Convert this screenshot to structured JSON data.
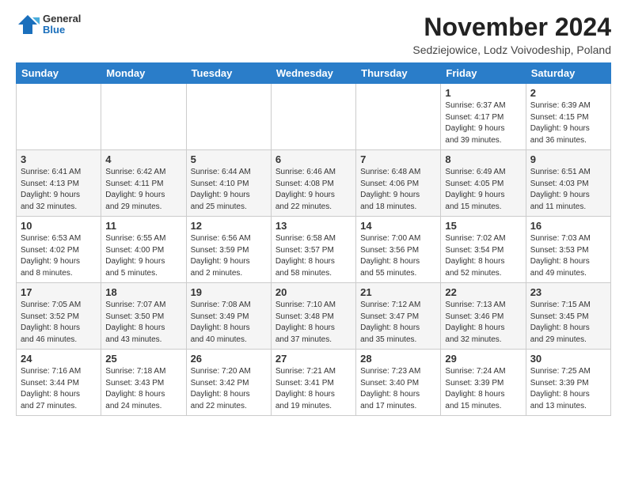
{
  "logo": {
    "general": "General",
    "blue": "Blue"
  },
  "title": "November 2024",
  "location": "Sedziejowice, Lodz Voivodeship, Poland",
  "headers": [
    "Sunday",
    "Monday",
    "Tuesday",
    "Wednesday",
    "Thursday",
    "Friday",
    "Saturday"
  ],
  "weeks": [
    [
      {
        "day": "",
        "info": ""
      },
      {
        "day": "",
        "info": ""
      },
      {
        "day": "",
        "info": ""
      },
      {
        "day": "",
        "info": ""
      },
      {
        "day": "",
        "info": ""
      },
      {
        "day": "1",
        "info": "Sunrise: 6:37 AM\nSunset: 4:17 PM\nDaylight: 9 hours\nand 39 minutes."
      },
      {
        "day": "2",
        "info": "Sunrise: 6:39 AM\nSunset: 4:15 PM\nDaylight: 9 hours\nand 36 minutes."
      }
    ],
    [
      {
        "day": "3",
        "info": "Sunrise: 6:41 AM\nSunset: 4:13 PM\nDaylight: 9 hours\nand 32 minutes."
      },
      {
        "day": "4",
        "info": "Sunrise: 6:42 AM\nSunset: 4:11 PM\nDaylight: 9 hours\nand 29 minutes."
      },
      {
        "day": "5",
        "info": "Sunrise: 6:44 AM\nSunset: 4:10 PM\nDaylight: 9 hours\nand 25 minutes."
      },
      {
        "day": "6",
        "info": "Sunrise: 6:46 AM\nSunset: 4:08 PM\nDaylight: 9 hours\nand 22 minutes."
      },
      {
        "day": "7",
        "info": "Sunrise: 6:48 AM\nSunset: 4:06 PM\nDaylight: 9 hours\nand 18 minutes."
      },
      {
        "day": "8",
        "info": "Sunrise: 6:49 AM\nSunset: 4:05 PM\nDaylight: 9 hours\nand 15 minutes."
      },
      {
        "day": "9",
        "info": "Sunrise: 6:51 AM\nSunset: 4:03 PM\nDaylight: 9 hours\nand 11 minutes."
      }
    ],
    [
      {
        "day": "10",
        "info": "Sunrise: 6:53 AM\nSunset: 4:02 PM\nDaylight: 9 hours\nand 8 minutes."
      },
      {
        "day": "11",
        "info": "Sunrise: 6:55 AM\nSunset: 4:00 PM\nDaylight: 9 hours\nand 5 minutes."
      },
      {
        "day": "12",
        "info": "Sunrise: 6:56 AM\nSunset: 3:59 PM\nDaylight: 9 hours\nand 2 minutes."
      },
      {
        "day": "13",
        "info": "Sunrise: 6:58 AM\nSunset: 3:57 PM\nDaylight: 8 hours\nand 58 minutes."
      },
      {
        "day": "14",
        "info": "Sunrise: 7:00 AM\nSunset: 3:56 PM\nDaylight: 8 hours\nand 55 minutes."
      },
      {
        "day": "15",
        "info": "Sunrise: 7:02 AM\nSunset: 3:54 PM\nDaylight: 8 hours\nand 52 minutes."
      },
      {
        "day": "16",
        "info": "Sunrise: 7:03 AM\nSunset: 3:53 PM\nDaylight: 8 hours\nand 49 minutes."
      }
    ],
    [
      {
        "day": "17",
        "info": "Sunrise: 7:05 AM\nSunset: 3:52 PM\nDaylight: 8 hours\nand 46 minutes."
      },
      {
        "day": "18",
        "info": "Sunrise: 7:07 AM\nSunset: 3:50 PM\nDaylight: 8 hours\nand 43 minutes."
      },
      {
        "day": "19",
        "info": "Sunrise: 7:08 AM\nSunset: 3:49 PM\nDaylight: 8 hours\nand 40 minutes."
      },
      {
        "day": "20",
        "info": "Sunrise: 7:10 AM\nSunset: 3:48 PM\nDaylight: 8 hours\nand 37 minutes."
      },
      {
        "day": "21",
        "info": "Sunrise: 7:12 AM\nSunset: 3:47 PM\nDaylight: 8 hours\nand 35 minutes."
      },
      {
        "day": "22",
        "info": "Sunrise: 7:13 AM\nSunset: 3:46 PM\nDaylight: 8 hours\nand 32 minutes."
      },
      {
        "day": "23",
        "info": "Sunrise: 7:15 AM\nSunset: 3:45 PM\nDaylight: 8 hours\nand 29 minutes."
      }
    ],
    [
      {
        "day": "24",
        "info": "Sunrise: 7:16 AM\nSunset: 3:44 PM\nDaylight: 8 hours\nand 27 minutes."
      },
      {
        "day": "25",
        "info": "Sunrise: 7:18 AM\nSunset: 3:43 PM\nDaylight: 8 hours\nand 24 minutes."
      },
      {
        "day": "26",
        "info": "Sunrise: 7:20 AM\nSunset: 3:42 PM\nDaylight: 8 hours\nand 22 minutes."
      },
      {
        "day": "27",
        "info": "Sunrise: 7:21 AM\nSunset: 3:41 PM\nDaylight: 8 hours\nand 19 minutes."
      },
      {
        "day": "28",
        "info": "Sunrise: 7:23 AM\nSunset: 3:40 PM\nDaylight: 8 hours\nand 17 minutes."
      },
      {
        "day": "29",
        "info": "Sunrise: 7:24 AM\nSunset: 3:39 PM\nDaylight: 8 hours\nand 15 minutes."
      },
      {
        "day": "30",
        "info": "Sunrise: 7:25 AM\nSunset: 3:39 PM\nDaylight: 8 hours\nand 13 minutes."
      }
    ]
  ]
}
